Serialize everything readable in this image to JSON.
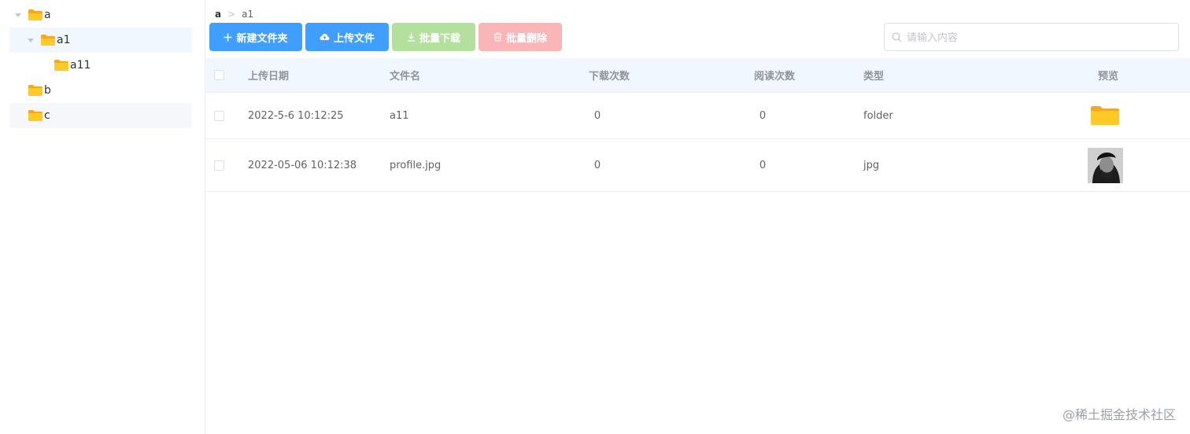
{
  "tree": {
    "nodes": [
      {
        "label": "a",
        "expanded": true
      },
      {
        "label": "a1",
        "expanded": true
      },
      {
        "label": "a11"
      },
      {
        "label": "b"
      },
      {
        "label": "c"
      }
    ]
  },
  "breadcrumb": {
    "root": "a",
    "current": "a1"
  },
  "toolbar": {
    "new_folder": "新建文件夹",
    "upload": "上传文件",
    "batch_download": "批量下载",
    "batch_delete": "批量删除"
  },
  "search": {
    "placeholder": "请输入内容"
  },
  "table": {
    "headers": {
      "date": "上传日期",
      "name": "文件名",
      "downloads": "下载次数",
      "reads": "阅读次数",
      "type": "类型",
      "preview": "预览"
    },
    "rows": [
      {
        "date": "2022-5-6 10:12:25",
        "name": "a11",
        "downloads": "0",
        "reads": "0",
        "type": "folder",
        "preview": "folder-icon"
      },
      {
        "date": "2022-05-06 10:12:38",
        "name": "profile.jpg",
        "downloads": "0",
        "reads": "0",
        "type": "jpg",
        "preview": "image-thumbnail"
      }
    ]
  },
  "colors": {
    "primary": "#409eff",
    "success_disabled": "#b3e19d",
    "danger_disabled": "#fab6b6",
    "folder": "#ffc107"
  },
  "watermark": "@稀土掘金技术社区"
}
